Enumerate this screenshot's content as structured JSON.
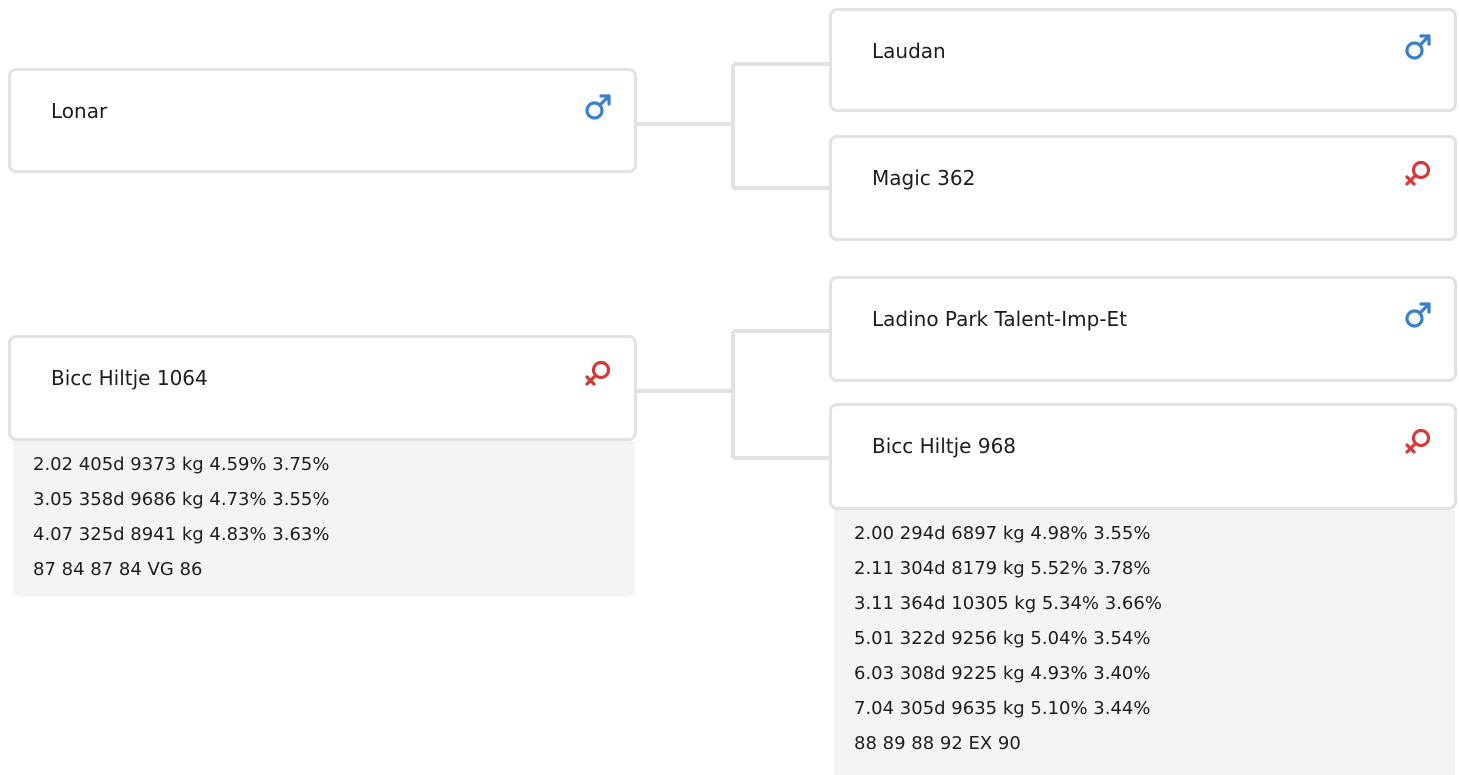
{
  "colors": {
    "male": "#3a7fca",
    "female": "#d33a3a",
    "card_border": "#e2e2e2",
    "stats_background": "#f4f4f4"
  },
  "pedigree": {
    "sire": {
      "name": "Lonar",
      "sex_icon": "male-icon",
      "sire": {
        "name": "Laudan",
        "sex_icon": "male-icon"
      },
      "dam": {
        "name": "Magic 362",
        "sex_icon": "female-icon"
      }
    },
    "dam": {
      "name": "Bicc Hiltje 1064",
      "sex_icon": "female-icon",
      "stats": [
        "2.02 405d 9373 kg 4.59% 3.75%",
        "3.05 358d 9686 kg 4.73% 3.55%",
        "4.07 325d 8941 kg 4.83% 3.63%",
        "87 84 87 84 VG 86"
      ],
      "sire": {
        "name": "Ladino Park Talent-Imp-Et",
        "sex_icon": "male-icon"
      },
      "dam": {
        "name": "Bicc Hiltje 968",
        "sex_icon": "female-icon",
        "stats": [
          "2.00 294d 6897 kg 4.98% 3.55%",
          "2.11 304d 8179 kg 5.52% 3.78%",
          "3.11 364d 10305 kg 5.34% 3.66%",
          "5.01 322d 9256 kg 5.04% 3.54%",
          "6.03 308d 9225 kg 4.93% 3.40%",
          "7.04 305d 9635 kg 5.10% 3.44%",
          "88 89 88 92 EX 90"
        ]
      }
    }
  }
}
